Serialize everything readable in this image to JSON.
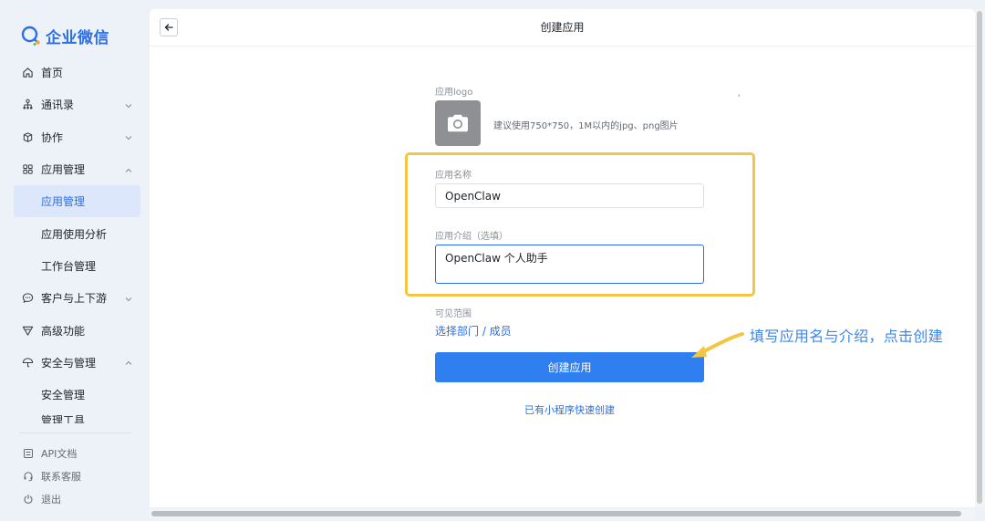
{
  "app": {
    "brand_name": "企业微信"
  },
  "sidebar": {
    "items": [
      {
        "label": "首页"
      },
      {
        "label": "通讯录"
      },
      {
        "label": "协作"
      },
      {
        "label": "应用管理"
      },
      {
        "label": "应用管理"
      },
      {
        "label": "应用使用分析"
      },
      {
        "label": "工作台管理"
      },
      {
        "label": "客户与上下游"
      },
      {
        "label": "高级功能"
      },
      {
        "label": "安全与管理"
      },
      {
        "label": "安全管理"
      },
      {
        "label": "管理工具"
      }
    ],
    "footer": [
      {
        "label": "API文档"
      },
      {
        "label": "联系客服"
      },
      {
        "label": "退出"
      }
    ]
  },
  "header": {
    "title": "创建应用"
  },
  "form": {
    "logo_label": "应用logo",
    "logo_hint": "建议使用750*750，1M以内的jpg、png图片",
    "stray_mark": "'",
    "name_label": "应用名称",
    "name_value": "OpenClaw",
    "desc_label": "应用介绍（选填）",
    "desc_value": "OpenClaw 个人助手",
    "scope_label": "可见范围",
    "scope_link": "选择部门 / 成员",
    "create_button": "创建应用",
    "mini_program_link": "已有小程序快速创建"
  },
  "annotation": {
    "text": "填写应用名与介绍，点击创建",
    "color": "#3d86ea",
    "highlight_color": "#f4c542"
  },
  "colors": {
    "accent": "#2b6fe6",
    "button": "#2f7ff0"
  }
}
